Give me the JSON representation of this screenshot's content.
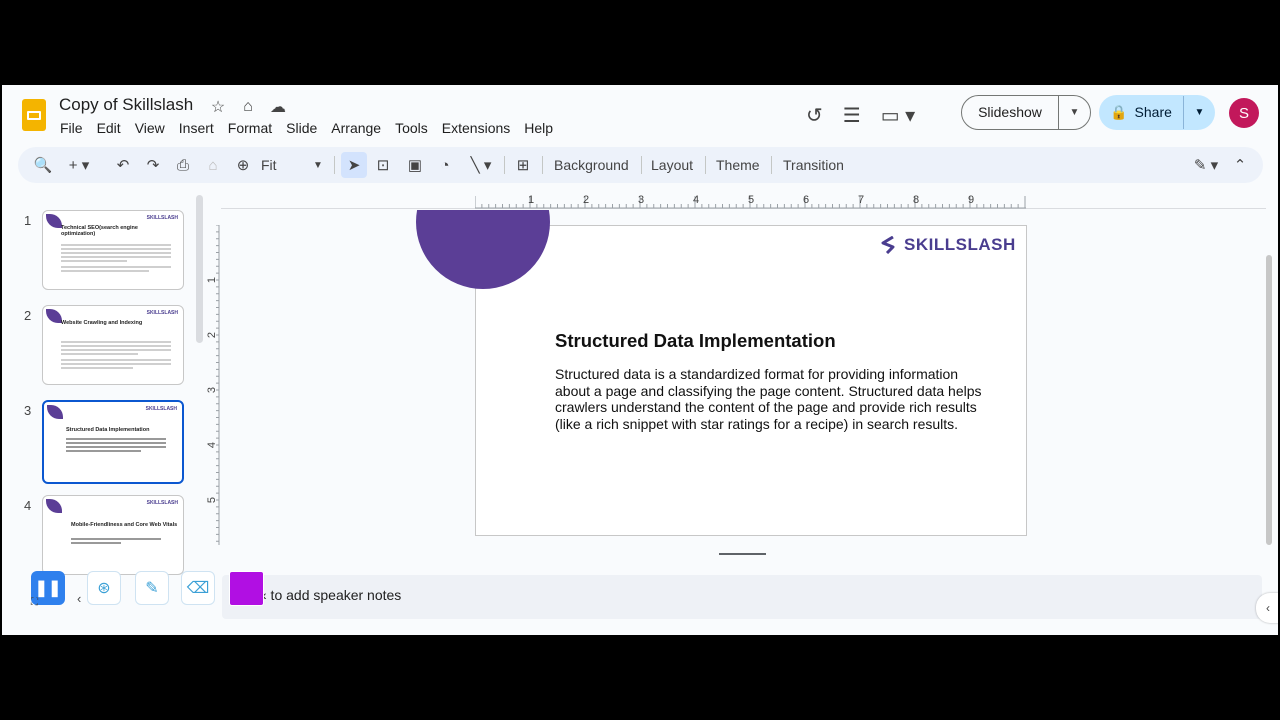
{
  "header": {
    "doc_title": "Copy of Skillslash",
    "menu": [
      "File",
      "Edit",
      "View",
      "Insert",
      "Format",
      "Slide",
      "Arrange",
      "Tools",
      "Extensions",
      "Help"
    ],
    "slideshow_label": "Slideshow",
    "share_label": "Share",
    "avatar_initial": "S"
  },
  "toolbar": {
    "zoom_label": "Fit",
    "background_label": "Background",
    "layout_label": "Layout",
    "theme_label": "Theme",
    "transition_label": "Transition"
  },
  "rulers": {
    "top_ticks": [
      "1",
      "2",
      "3",
      "4",
      "5",
      "6",
      "7",
      "8",
      "9"
    ],
    "left_ticks": [
      "1",
      "2",
      "3",
      "4",
      "5"
    ]
  },
  "filmstrip": [
    {
      "number": "1",
      "title": "Technical SEO(search engine optimization)",
      "brand": "SKILLSLASH"
    },
    {
      "number": "2",
      "title": "Website Crawling and Indexing",
      "brand": "SKILLSLASH"
    },
    {
      "number": "3",
      "title": "Structured Data Implementation",
      "brand": "SKILLSLASH"
    },
    {
      "number": "4",
      "title": "Mobile-Friendliness and Core Web Vitals",
      "brand": "SKILLSLASH"
    }
  ],
  "slide": {
    "brand": "SKILLSLASH",
    "title": "Structured Data Implementation",
    "body": "Structured data is a standardized format for providing information about a page and classifying the page content. Structured data helps crawlers understand the content of the page and provide rich results (like a rich snippet with star ratings for a recipe) in search results."
  },
  "notes": {
    "placeholder": "‹ to add speaker notes"
  },
  "colors": {
    "accent": "#0b57d0",
    "brand_purple": "#5b3e96",
    "share_bg": "#c2e7ff",
    "avatar": "#c2185b",
    "pen_swatch": "#b10fe3"
  }
}
